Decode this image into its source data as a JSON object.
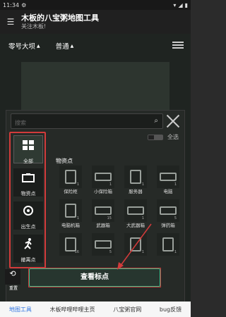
{
  "status": {
    "time": "11:34"
  },
  "appbar": {
    "title": "木板的八宝粥地图工具",
    "subtitle": "关注木板!"
  },
  "map": {
    "location": "零号大坝",
    "mode": "普通"
  },
  "panel": {
    "search_placeholder": "搜索",
    "select_all": "全选",
    "section_title": "物资点",
    "categories": [
      {
        "label": "全部",
        "icon": "grid-icon"
      },
      {
        "label": "物资点",
        "icon": "box-icon"
      },
      {
        "label": "出生点",
        "icon": "location-icon"
      },
      {
        "label": "撤离点",
        "icon": "run-icon"
      }
    ],
    "items": [
      {
        "label": "保险柜",
        "count": "1"
      },
      {
        "label": "小保险箱",
        "count": "1"
      },
      {
        "label": "服务器",
        "count": "1"
      },
      {
        "label": "电脑",
        "count": "1"
      },
      {
        "label": "电脑机箱",
        "count": "1"
      },
      {
        "label": "武器箱",
        "count": "15"
      },
      {
        "label": "大武器箱",
        "count": "1"
      },
      {
        "label": "弹药箱",
        "count": "5"
      },
      {
        "label": "",
        "count": "16"
      },
      {
        "label": "",
        "count": "5"
      },
      {
        "label": "",
        "count": "1"
      },
      {
        "label": "",
        "count": "1"
      }
    ]
  },
  "actions": {
    "refresh_label": "重置",
    "view_button": "查看标点"
  },
  "nav": {
    "items": [
      "地图工具",
      "木板哔哩哔哩主页",
      "八宝粥官网",
      "bug反馈"
    ]
  }
}
